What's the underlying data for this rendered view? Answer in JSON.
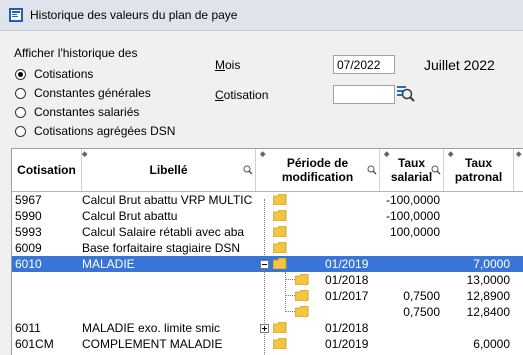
{
  "window": {
    "title": "Historique des valeurs du plan de paye"
  },
  "history": {
    "heading": "Afficher l'historique des",
    "options": [
      {
        "label": "Cotisations",
        "checked": true
      },
      {
        "label": "Constantes générales",
        "checked": false
      },
      {
        "label": "Constantes salariés",
        "checked": false
      },
      {
        "label": "Cotisations agrégées DSN",
        "checked": false
      }
    ]
  },
  "filters": {
    "month_label": "Mois",
    "month_value": "07/2022",
    "month_display": "Juillet 2022",
    "cotisation_label": "Cotisation",
    "cotisation_value": ""
  },
  "table": {
    "columns": {
      "cotisation": "Cotisation",
      "libelle": "Libellé",
      "periode_1": "Période de",
      "periode_2": "modification",
      "taux_salarial_1": "Taux",
      "taux_salarial_2": "salarial",
      "taux_patronal_1": "Taux",
      "taux_patronal_2": "patronal"
    },
    "rows": [
      {
        "code": "5967",
        "libelle": "Calcul Brut abattu VRP MULTIC",
        "periode": "",
        "salarial": "-100,0000",
        "patronal": ""
      },
      {
        "code": "5990",
        "libelle": "Calcul Brut abattu",
        "periode": "",
        "salarial": "-100,0000",
        "patronal": ""
      },
      {
        "code": "5993",
        "libelle": "Calcul Salaire rétabli avec aba",
        "periode": "",
        "salarial": "100,0000",
        "patronal": ""
      },
      {
        "code": "6009",
        "libelle": "Base forfaitaire stagiaire DSN",
        "periode": "",
        "salarial": "",
        "patronal": ""
      },
      {
        "code": "6010",
        "libelle": "MALADIE",
        "periode": "01/2019",
        "salarial": "",
        "patronal": "7,0000"
      },
      {
        "code": "",
        "libelle": "",
        "periode": "01/2018",
        "salarial": "",
        "patronal": "13,0000"
      },
      {
        "code": "",
        "libelle": "",
        "periode": "01/2017",
        "salarial": "0,7500",
        "patronal": "12,8900"
      },
      {
        "code": "",
        "libelle": "",
        "periode": "",
        "salarial": "0,7500",
        "patronal": "12,8400"
      },
      {
        "code": "6011",
        "libelle": "MALADIE exo. limite smic",
        "periode": "01/2018",
        "salarial": "",
        "patronal": ""
      },
      {
        "code": "601CM",
        "libelle": "COMPLEMENT MALADIE",
        "periode": "01/2019",
        "salarial": "",
        "patronal": "6,0000"
      }
    ]
  },
  "colors": {
    "selection": "#3875d7",
    "folder": "#f5c542",
    "titlebar": "#dfe4ec"
  },
  "icons": [
    "app-icon",
    "folder-icon",
    "search-icon",
    "expand-icon",
    "collapse-icon"
  ]
}
